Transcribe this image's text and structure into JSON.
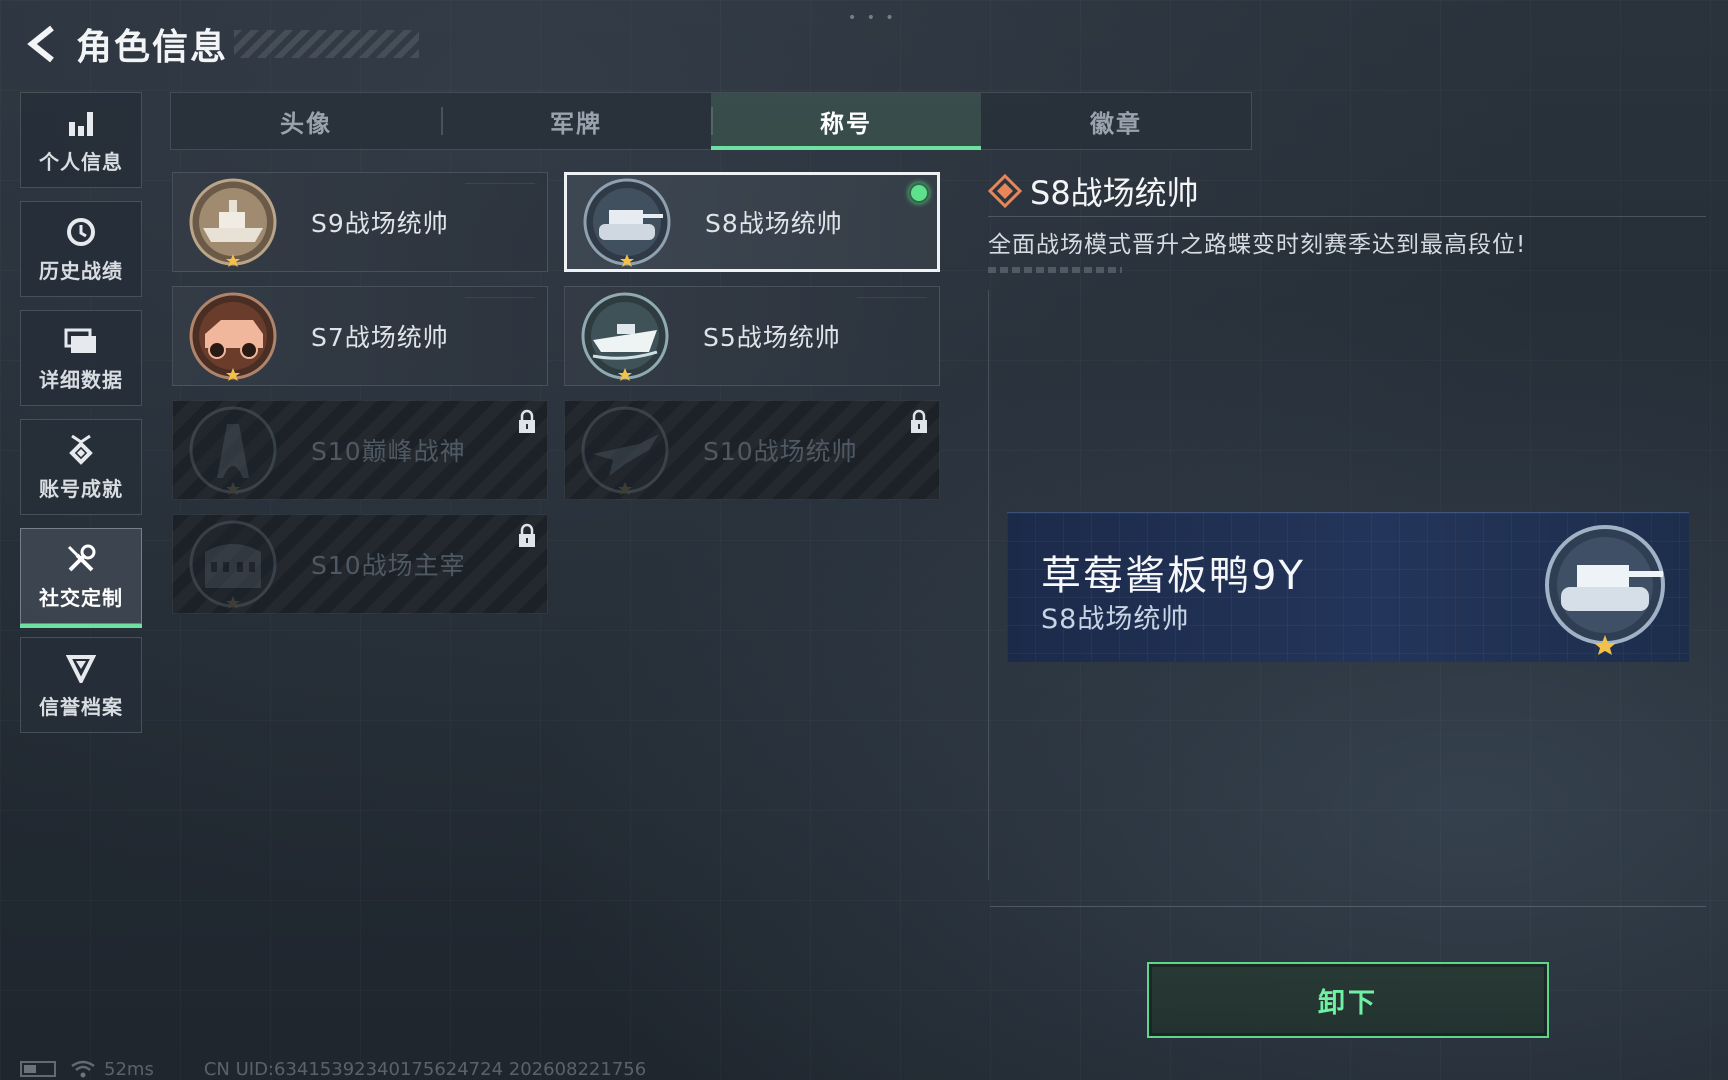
{
  "header": {
    "title": "角色信息"
  },
  "sidebar": {
    "items": [
      {
        "label": "个人信息",
        "icon": "bar-chart-icon",
        "active": false
      },
      {
        "label": "历史战绩",
        "icon": "clock-icon",
        "active": false
      },
      {
        "label": "详细数据",
        "icon": "folder-icon",
        "active": false
      },
      {
        "label": "账号成就",
        "icon": "medal-icon",
        "active": false
      },
      {
        "label": "社交定制",
        "icon": "tools-icon",
        "active": true
      },
      {
        "label": "信誉档案",
        "icon": "shield-badge-icon",
        "active": false
      }
    ]
  },
  "tabs": [
    {
      "label": "头像",
      "active": false
    },
    {
      "label": "军牌",
      "active": false
    },
    {
      "label": "称号",
      "active": true
    },
    {
      "label": "徽章",
      "active": false
    }
  ],
  "titles": [
    {
      "name": "S9战场统帅",
      "emblem": "warship-emblem-icon",
      "locked": false,
      "selected": false,
      "equipped": false
    },
    {
      "name": "S8战场统帅",
      "emblem": "tank-emblem-icon",
      "locked": false,
      "selected": true,
      "equipped": true
    },
    {
      "name": "S7战场统帅",
      "emblem": "armored-car-emblem-icon",
      "locked": false,
      "selected": false,
      "equipped": false
    },
    {
      "name": "S5战场统帅",
      "emblem": "speedboat-emblem-icon",
      "locked": false,
      "selected": false,
      "equipped": false
    },
    {
      "name": "S10巅峰战神",
      "emblem": "tower-emblem-icon",
      "locked": true,
      "selected": false,
      "equipped": false
    },
    {
      "name": "S10战场统帅",
      "emblem": "jet-emblem-icon",
      "locked": true,
      "selected": false,
      "equipped": false
    },
    {
      "name": "S10战场主宰",
      "emblem": "colosseum-emblem-icon",
      "locked": true,
      "selected": false,
      "equipped": false
    }
  ],
  "detail": {
    "title": "S8战场统帅",
    "description": "全面战场模式晋升之路蝶变时刻赛季达到最高段位!"
  },
  "nameplate": {
    "player_name": "草莓酱板鸭9Y",
    "title": "S8战场统帅"
  },
  "actions": {
    "unequip_label": "卸下"
  },
  "status": {
    "ping": "52ms",
    "uid": "CN UID:634153923401756247​24 202608221756"
  },
  "colors": {
    "accent": "#6fe0a0",
    "equipped": "#5fe08e",
    "nameplate_bg": "#23355a"
  }
}
